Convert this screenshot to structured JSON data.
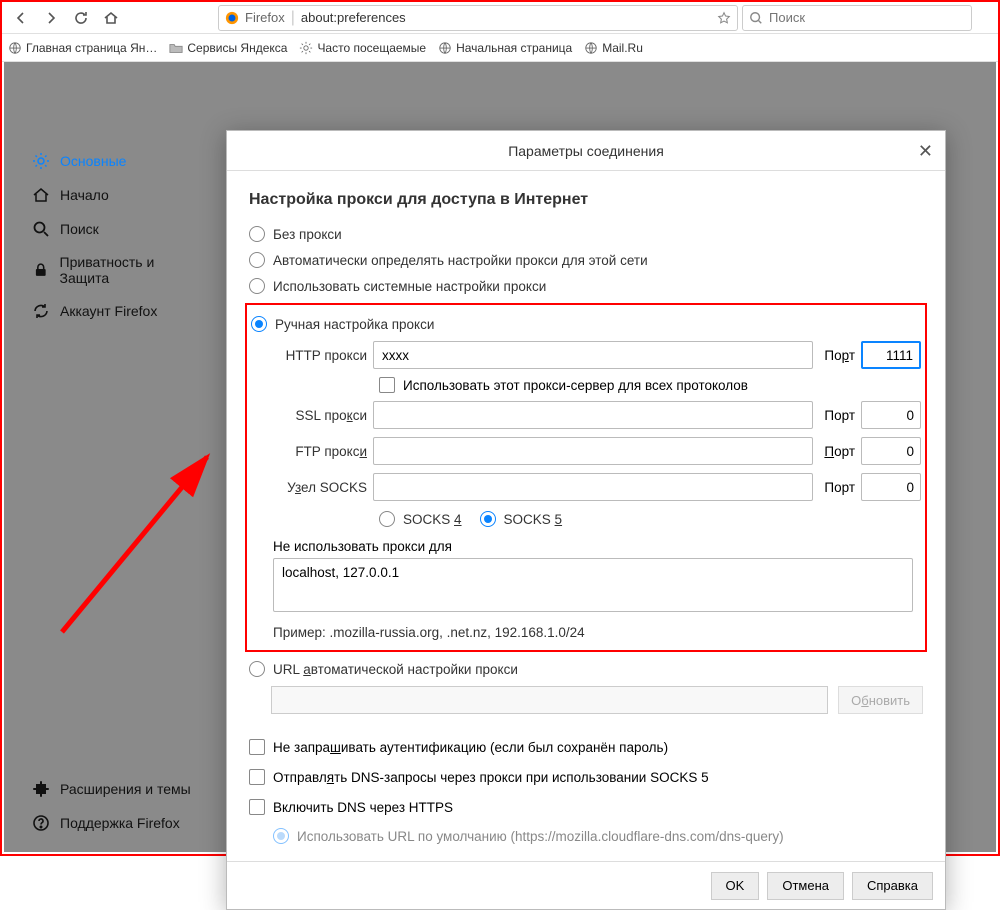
{
  "toolbar": {
    "url_prefix": "Firefox",
    "url": "about:preferences",
    "search_placeholder": "Поиск"
  },
  "bookmarks": {
    "yandex_home": "Главная страница Ян…",
    "yandex_services": "Сервисы Яндекса",
    "frequent": "Часто посещаемые",
    "start_page": "Начальная страница",
    "mailru": "Mail.Ru"
  },
  "sidebar": {
    "general": "Основные",
    "home": "Начало",
    "search": "Поиск",
    "privacy": "Приватность и Защита",
    "account": "Аккаунт Firefox",
    "extensions": "Расширения и темы",
    "support": "Поддержка Firefox"
  },
  "dialog": {
    "title": "Параметры соединения",
    "heading": "Настройка прокси для доступа в Интернет",
    "opt_no_proxy": "Без прокси",
    "opt_auto": "Автоматически определять настройки прокси для этой сети",
    "opt_system": "Использовать системные настройки прокси",
    "opt_manual": "Ручная настройка прокси",
    "http_label": "HTTP прокси",
    "http_value": "xxxx",
    "port_label": "Порт",
    "http_port": "1111",
    "use_all": "Использовать этот прокси-сервер для всех протоколов",
    "ssl_label": "SSL прокси",
    "ssl_value": "",
    "ssl_port": "0",
    "ftp_label": "FTP прокси",
    "ftp_value": "",
    "ftp_port": "0",
    "socks_label": "Узел SOCKS",
    "socks_value": "",
    "socks_port": "0",
    "socks4": "SOCKS 4",
    "socks5": "SOCKS 5",
    "noproxy_label": "Не использовать прокси для",
    "noproxy_value": "localhost, 127.0.0.1",
    "example": "Пример: .mozilla-russia.org, .net.nz, 192.168.1.0/24",
    "opt_url_auto": "URL автоматической настройки прокси",
    "refresh": "Обновить",
    "cb_noauth": "Не запрашивать аутентификацию (если был сохранён пароль)",
    "cb_dns_socks": "Отправлять DNS-запросы через прокси при использовании SOCKS 5",
    "cb_dns_https": "Включить DNS через HTTPS",
    "doh_default": "Использовать URL по умолчанию (https://mozilla.cloudflare-dns.com/dns-query)",
    "ok": "OK",
    "cancel": "Отмена",
    "help": "Справка"
  }
}
